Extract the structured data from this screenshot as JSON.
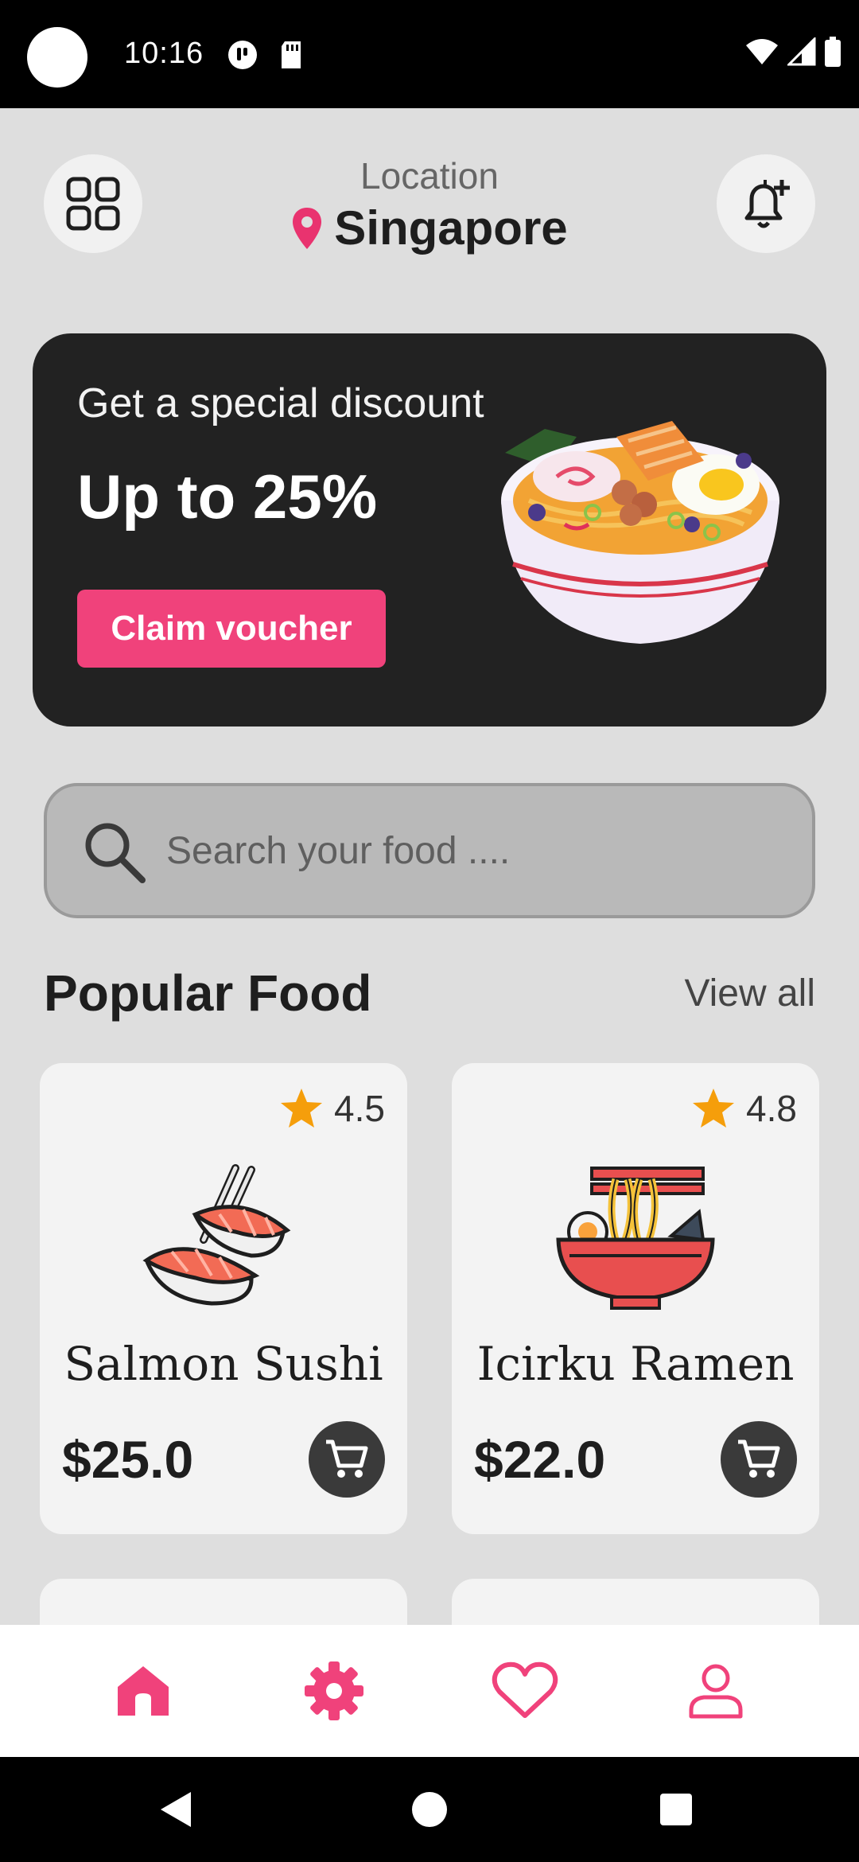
{
  "status_bar": {
    "time": "10:16"
  },
  "header": {
    "location_label": "Location",
    "location_value": "Singapore",
    "menu_icon": "grid-icon",
    "notification_icon": "bell-plus-icon"
  },
  "promo": {
    "subtitle": "Get a special discount",
    "title": "Up to 25%",
    "button_label": "Claim voucher",
    "image": "ramen-bowl-illustration"
  },
  "search": {
    "placeholder": "Search your food ...."
  },
  "popular": {
    "title": "Popular Food",
    "view_all": "View all",
    "items": [
      {
        "name": "Salmon Sushi",
        "price": "$25.0",
        "rating": "4.5",
        "icon": "salmon-sushi-icon"
      },
      {
        "name": "Icirku Ramen",
        "price": "$22.0",
        "rating": "4.8",
        "icon": "ramen-bowl-icon"
      }
    ]
  },
  "bottom_nav": {
    "items": [
      {
        "icon": "home-icon",
        "active": true
      },
      {
        "icon": "settings-icon",
        "active": false
      },
      {
        "icon": "heart-icon",
        "active": false
      },
      {
        "icon": "profile-icon",
        "active": false
      }
    ]
  },
  "colors": {
    "accent": "#f0427b",
    "dark": "#222222",
    "background": "#dedede",
    "star": "#f59e0b"
  }
}
